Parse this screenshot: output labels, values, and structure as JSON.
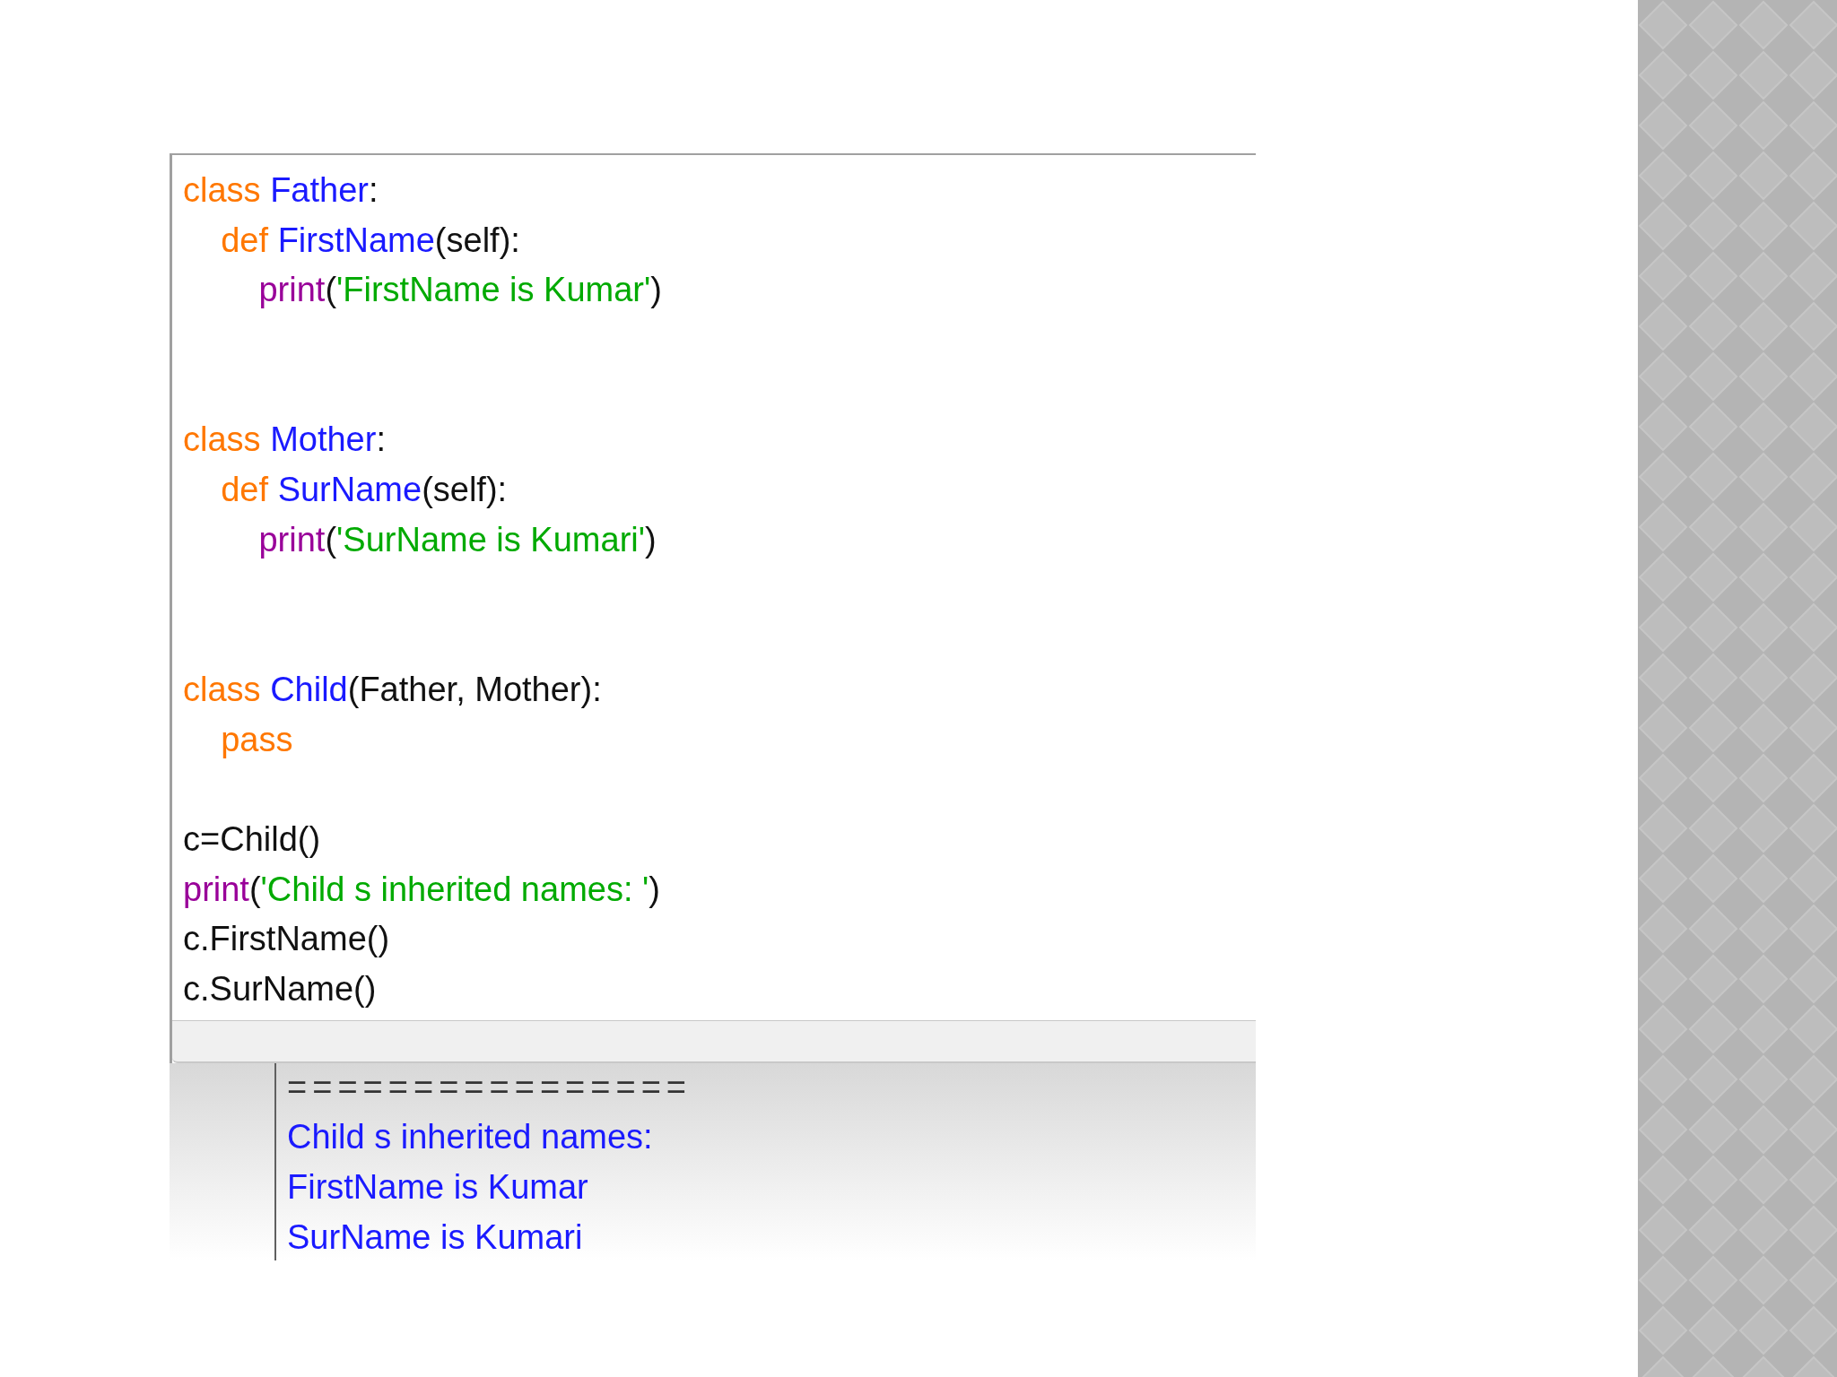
{
  "editor": {
    "lines": [
      {
        "kind": "code",
        "tokens": [
          {
            "kind": "keyword",
            "text": "class "
          },
          {
            "kind": "name",
            "text": "Father"
          },
          {
            "kind": "plain",
            "text": ":"
          }
        ]
      },
      {
        "kind": "code",
        "tokens": [
          {
            "kind": "keyword",
            "text": "    def "
          },
          {
            "kind": "name",
            "text": "FirstName"
          },
          {
            "kind": "plain",
            "text": "(self):"
          }
        ]
      },
      {
        "kind": "code",
        "tokens": [
          {
            "kind": "builtin",
            "text": "        print"
          },
          {
            "kind": "plain",
            "text": "("
          },
          {
            "kind": "string",
            "text": "'FirstName is Kumar'"
          },
          {
            "kind": "plain",
            "text": ")"
          }
        ]
      },
      {
        "kind": "blank"
      },
      {
        "kind": "blank"
      },
      {
        "kind": "code",
        "tokens": [
          {
            "kind": "keyword",
            "text": "class "
          },
          {
            "kind": "name",
            "text": "Mother"
          },
          {
            "kind": "plain",
            "text": ":"
          }
        ]
      },
      {
        "kind": "code",
        "tokens": [
          {
            "kind": "keyword",
            "text": "    def "
          },
          {
            "kind": "name",
            "text": "SurName"
          },
          {
            "kind": "plain",
            "text": "(self):"
          }
        ]
      },
      {
        "kind": "code",
        "tokens": [
          {
            "kind": "builtin",
            "text": "        print"
          },
          {
            "kind": "plain",
            "text": "("
          },
          {
            "kind": "string",
            "text": "'SurName is Kumari'"
          },
          {
            "kind": "plain",
            "text": ")"
          }
        ]
      },
      {
        "kind": "blank"
      },
      {
        "kind": "blank"
      },
      {
        "kind": "code",
        "tokens": [
          {
            "kind": "keyword",
            "text": "class "
          },
          {
            "kind": "name",
            "text": "Child"
          },
          {
            "kind": "plain",
            "text": "(Father, Mother):"
          }
        ]
      },
      {
        "kind": "code",
        "tokens": [
          {
            "kind": "keyword",
            "text": "    pass"
          }
        ]
      },
      {
        "kind": "blank"
      },
      {
        "kind": "code",
        "tokens": [
          {
            "kind": "plain",
            "text": "c=Child()"
          }
        ]
      },
      {
        "kind": "code",
        "tokens": [
          {
            "kind": "builtin",
            "text": "print"
          },
          {
            "kind": "plain",
            "text": "("
          },
          {
            "kind": "string",
            "text": "'Child s inherited names: '"
          },
          {
            "kind": "plain",
            "text": ")"
          }
        ]
      },
      {
        "kind": "code",
        "tokens": [
          {
            "kind": "plain",
            "text": "c.FirstName()"
          }
        ]
      },
      {
        "kind": "code",
        "tokens": [
          {
            "kind": "plain",
            "text": "c.SurName()"
          }
        ]
      }
    ]
  },
  "output": {
    "lines": [
      {
        "kind": "separator",
        "text": "================"
      },
      {
        "kind": "output",
        "text": "Child s inherited names:"
      },
      {
        "kind": "output",
        "text": "FirstName is Kumar"
      },
      {
        "kind": "output",
        "text": "SurName is Kumari"
      }
    ]
  }
}
